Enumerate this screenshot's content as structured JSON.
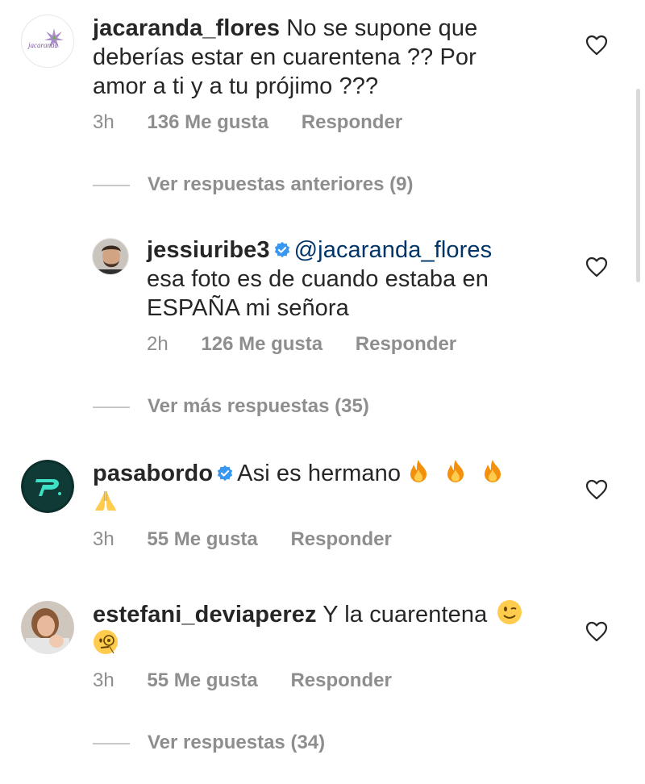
{
  "comments": [
    {
      "username": "jacaranda_flores",
      "text_line1": "No se supone que",
      "text_line2": "deberías estar en cuarentena ?? Por",
      "text_line3": "amor a ti y a tu prójimo ???",
      "time": "3h",
      "likes": "136 Me gusta",
      "reply": "Responder",
      "avatar_text": "jacaranda"
    },
    {
      "username": "jessiuribe3",
      "mention": "@jacaranda_flores",
      "text_line2": "esa foto es de cuando estaba en",
      "text_line3": "ESPAÑA mi señora",
      "time": "2h",
      "likes": "126 Me gusta",
      "reply": "Responder"
    },
    {
      "username": "pasabordo",
      "text_line1": "Asi es hermano",
      "time": "3h",
      "likes": "55 Me gusta",
      "reply": "Responder"
    },
    {
      "username": "estefani_deviaperez",
      "text_line1": "Y la cuarentena",
      "time": "3h",
      "likes": "55 Me gusta",
      "reply": "Responder"
    }
  ],
  "threads": {
    "previous": "Ver respuestas anteriores (9)",
    "more": "Ver más respuestas (35)",
    "replies": "Ver respuestas (34)"
  },
  "icons": {
    "heart": "heart-icon",
    "verified": "verified-badge-icon",
    "fire": "fire-emoji",
    "pray": "folded-hands-emoji",
    "wink": "winking-face-emoji",
    "monocle": "face-with-monocle-emoji"
  },
  "colors": {
    "text": "#262626",
    "meta": "#8e8e8e",
    "verified": "#3897f0",
    "mention": "#003569"
  }
}
